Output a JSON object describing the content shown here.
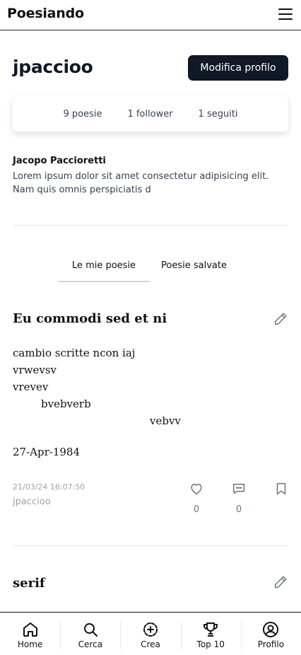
{
  "header": {
    "title": "Poesiando",
    "menu_icon": "hamburger-menu-icon"
  },
  "profile": {
    "username": "jpaccioo",
    "edit_button": "Modifica profilo",
    "stats": {
      "poems": "9 poesie",
      "followers": "1 follower",
      "following": "1 seguiti"
    },
    "full_name": "Jacopo Paccioretti",
    "bio": "Lorem ipsum dolor sit amet consectetur adipisicing elit. Nam quis omnis perspiciatis d"
  },
  "tabs": [
    {
      "label": "Le mie poesie",
      "active": true
    },
    {
      "label": "Poesie salvate",
      "active": false
    }
  ],
  "poems": [
    {
      "title": "Eu commodi sed et ni",
      "lines": [
        "cambio scritte ncon iaj",
        "vrwevsv",
        "vrevev",
        "bvebverb",
        "vebvv",
        "27-Apr-1984"
      ],
      "timestamp": "21/03/24 16:07:50",
      "author": "jpaccioo",
      "likes": "0",
      "comments": "0"
    },
    {
      "title": "serif"
    }
  ],
  "bottom_nav": [
    {
      "label": "Home",
      "icon": "home-icon"
    },
    {
      "label": "Cerca",
      "icon": "search-icon"
    },
    {
      "label": "Crea",
      "icon": "create-plus-icon"
    },
    {
      "label": "Top 10",
      "icon": "trophy-icon"
    },
    {
      "label": "Profilo",
      "icon": "profile-icon"
    }
  ],
  "colors": {
    "primary": "#111827",
    "muted": "#9ca3af",
    "divider": "#e5e7eb"
  }
}
